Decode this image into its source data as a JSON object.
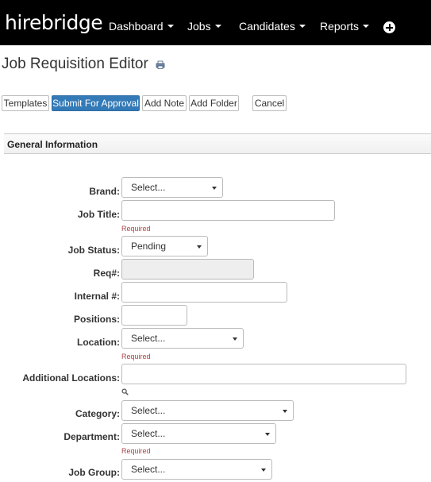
{
  "app": {
    "logo": "hirebridge"
  },
  "nav": {
    "items": [
      {
        "label": "Dashboard"
      },
      {
        "label": "Jobs"
      },
      {
        "label": "Candidates"
      },
      {
        "label": "Reports"
      }
    ]
  },
  "page": {
    "title": "Job Requisition Editor"
  },
  "toolbar": {
    "templates": "Templates",
    "submit": "Submit For Approval",
    "add_note": "Add Note",
    "add_folder": "Add Folder",
    "cancel": "Cancel"
  },
  "section": {
    "title": "General Information"
  },
  "form": {
    "brand": {
      "label": "Brand:",
      "value": "Select..."
    },
    "job_title": {
      "label": "Job Title:",
      "value": "",
      "required": "Required"
    },
    "job_status": {
      "label": "Job Status:",
      "value": "Pending"
    },
    "req_num": {
      "label": "Req#:",
      "value": ""
    },
    "internal_num": {
      "label": "Internal #:",
      "value": ""
    },
    "positions": {
      "label": "Positions:",
      "value": ""
    },
    "location": {
      "label": "Location:",
      "value": "Select...",
      "required": "Required"
    },
    "additional_locations": {
      "label": "Additional Locations:",
      "value": ""
    },
    "category": {
      "label": "Category:",
      "value": "Select..."
    },
    "department": {
      "label": "Department:",
      "value": "Select...",
      "required": "Required"
    },
    "job_group": {
      "label": "Job Group:",
      "value": "Select..."
    }
  },
  "colors": {
    "nav_bg": "#000000",
    "primary": "#337ab7",
    "required": "#a94442"
  }
}
